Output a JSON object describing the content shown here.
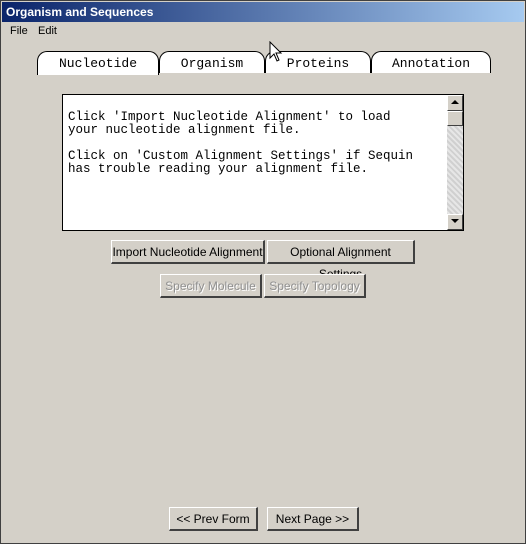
{
  "window": {
    "title": "Organism and Sequences"
  },
  "menu": {
    "items": [
      "File",
      "Edit"
    ]
  },
  "tabs": [
    {
      "label": "Nucleotide",
      "active": true
    },
    {
      "label": "Organism",
      "active": false
    },
    {
      "label": "Proteins",
      "active": false
    },
    {
      "label": "Annotation",
      "active": false
    }
  ],
  "instructions": {
    "line1": "Click 'Import Nucleotide Alignment' to load",
    "line2": "your nucleotide alignment file.",
    "line3": "Click on 'Custom Alignment Settings' if Sequin",
    "line4": "has trouble reading your alignment file."
  },
  "buttons": {
    "import_alignment": "Import Nucleotide Alignment",
    "optional_settings": "Optional Alignment Settings",
    "specify_molecule": "Specify Molecule",
    "specify_topology": "Specify Topology",
    "prev_form": "<< Prev Form",
    "next_page": "Next Page >>"
  },
  "icons": {
    "scroll_up": "arrow-up-icon",
    "scroll_down": "arrow-down-icon",
    "cursor": "mouse-pointer-icon"
  }
}
